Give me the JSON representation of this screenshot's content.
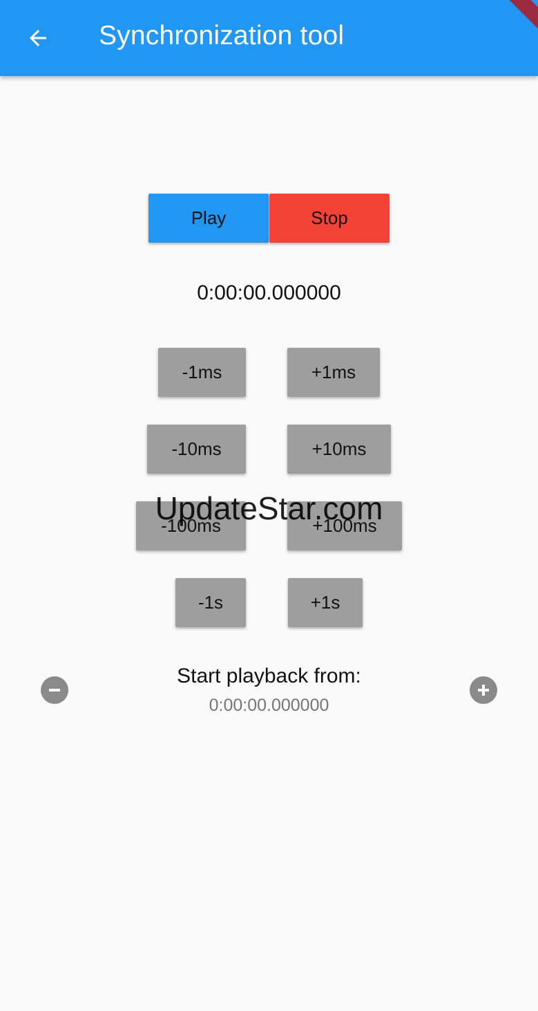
{
  "app_bar": {
    "title": "Synchronization tool",
    "back_icon": "arrow-back-icon",
    "background_color": "#2196f3",
    "debug_banner": "DEBUG"
  },
  "controls": {
    "play_label": "Play",
    "stop_label": "Stop",
    "play_color": "#2196f3",
    "stop_color": "#f44336"
  },
  "timer": {
    "value": "0:00:00.000000"
  },
  "adjust_buttons": {
    "minus_1ms": "-1ms",
    "plus_1ms": "+1ms",
    "minus_10ms": "-10ms",
    "plus_10ms": "+10ms",
    "minus_100ms": "-100ms",
    "plus_100ms": "+100ms",
    "minus_1s": "-1s",
    "plus_1s": "+1s",
    "color": "#9e9e9e"
  },
  "start_playback": {
    "label": "Start playback from:",
    "value": "0:00:00.000000",
    "decrease_icon": "remove-circle-icon",
    "increase_icon": "add-circle-icon"
  },
  "watermark": "UpdateStar.com"
}
